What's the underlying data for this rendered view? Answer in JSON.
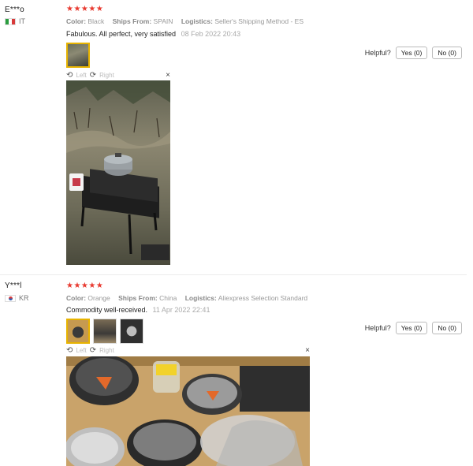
{
  "reviews": [
    {
      "user": "E***o",
      "country": "IT",
      "stars": "★★★★★",
      "color_label": "Color:",
      "color_value": "Black",
      "ships_label": "Ships From:",
      "ships_value": "SPAIN",
      "logistics_label": "Logistics:",
      "logistics_value": "Seller's Shipping Method - ES",
      "comment": "Fabulous. All perfect, very satisfied",
      "date": "08 Feb 2022 20:43",
      "helpful_label": "Helpful?",
      "yes_label": "Yes (0)",
      "no_label": "No (0)",
      "viewer": {
        "left_label": "Left",
        "right_label": "Right",
        "close": "×"
      }
    },
    {
      "user": "Y***l",
      "country": "KR",
      "stars": "★★★★★",
      "color_label": "Color:",
      "color_value": "Orange",
      "ships_label": "Ships From:",
      "ships_value": "China",
      "logistics_label": "Logistics:",
      "logistics_value": "Aliexpress Selection Standard",
      "comment": "Commodity well-received.",
      "date": "11 Apr 2022 22:41",
      "helpful_label": "Helpful?",
      "yes_label": "Yes (0)",
      "no_label": "No (0)",
      "viewer": {
        "left_label": "Left",
        "right_label": "Right",
        "close": "×"
      }
    }
  ],
  "icons": {
    "rotate_left": "⟲",
    "rotate_right": "⟳"
  },
  "colors": {
    "star": "#e8392f",
    "active_thumb": "#e7b300"
  }
}
